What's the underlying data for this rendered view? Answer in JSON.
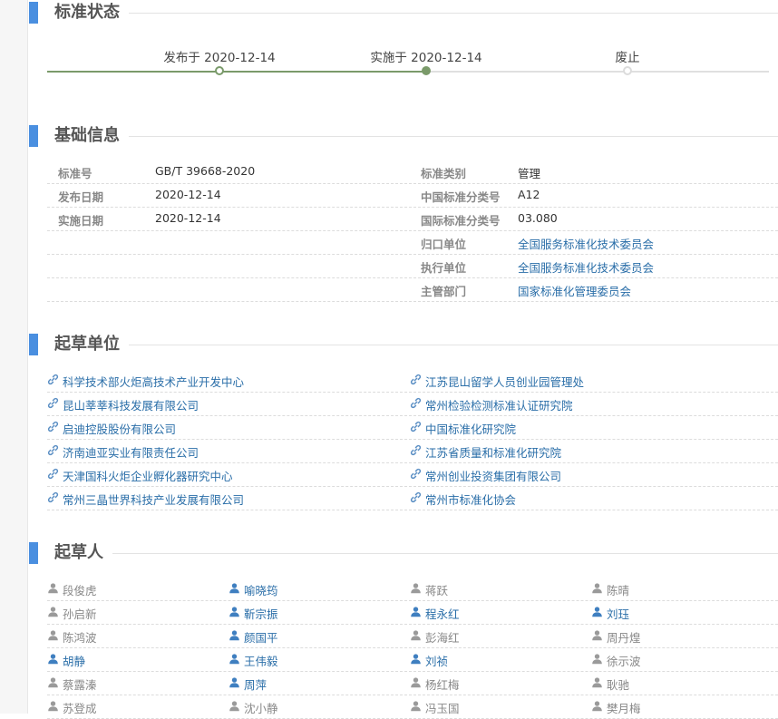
{
  "sections": {
    "status": "标准状态",
    "basic": "基础信息",
    "units": "起草单位",
    "people": "起草人"
  },
  "timeline": {
    "published": "发布于 2020-12-14",
    "implemented": "实施于 2020-12-14",
    "abolished": "废止"
  },
  "info": [
    {
      "l_label": "标准号",
      "l_value": "GB/T 39668-2020",
      "r_label": "标准类别",
      "r_value": "管理"
    },
    {
      "l_label": "发布日期",
      "l_value": "2020-12-14",
      "r_label": "中国标准分类号",
      "r_value": "A12"
    },
    {
      "l_label": "实施日期",
      "l_value": "2020-12-14",
      "r_label": "国际标准分类号",
      "r_value": "03.080"
    },
    {
      "l_label": "",
      "l_value": "",
      "r_label": "归口单位",
      "r_value": "全国服务标准化技术委员会"
    },
    {
      "l_label": "",
      "l_value": "",
      "r_label": "执行单位",
      "r_value": "全国服务标准化技术委员会"
    },
    {
      "l_label": "",
      "l_value": "",
      "r_label": "主管部门",
      "r_value": "国家标准化管理委员会"
    }
  ],
  "units": [
    [
      "科学技术部火炬高技术产业开发中心",
      "江苏昆山留学人员创业园管理处"
    ],
    [
      "昆山莘莘科技发展有限公司",
      "常州检验检测标准认证研究院"
    ],
    [
      "启迪控股股份有限公司",
      "中国标准化研究院"
    ],
    [
      "济南迪亚实业有限责任公司",
      "江苏省质量和标准化研究院"
    ],
    [
      "天津国科火炬企业孵化器研究中心",
      "常州创业投资集团有限公司"
    ],
    [
      "常州三晶世界科技产业发展有限公司",
      "常州市标准化协会"
    ]
  ],
  "people": [
    [
      "段俊虎",
      "喻晓筠",
      "蒋跃",
      "陈晴"
    ],
    [
      "孙启新",
      "靳宗振",
      "程永红",
      "刘珏"
    ],
    [
      "陈鸿波",
      "颜国平",
      "彭海红",
      "周丹煌"
    ],
    [
      "胡静",
      "王伟毅",
      "刘祯",
      "徐示波"
    ],
    [
      "蔡露溱",
      "周萍",
      "杨红梅",
      "耿驰"
    ],
    [
      "苏登成",
      "沈小静",
      "冯玉国",
      "樊月梅"
    ]
  ],
  "colors": {
    "accent": "#4a8fe0",
    "timeline_done": "#7a9a6a",
    "link": "#2a6ea8",
    "label": "#888888"
  },
  "icons": {
    "unit": "link-icon",
    "person": "user-icon"
  }
}
